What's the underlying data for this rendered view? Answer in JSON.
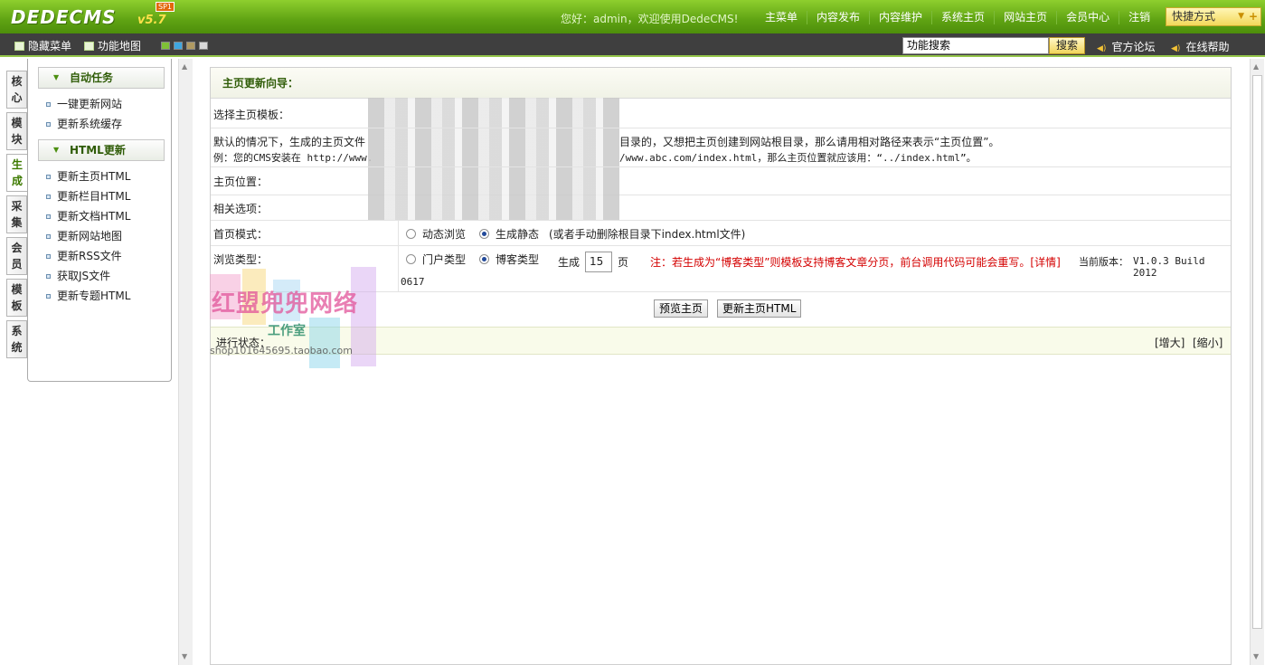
{
  "header": {
    "brand": "DEDECMS",
    "version": "v5.7",
    "sp": "SP1",
    "welcome": "您好：admin，欢迎使用DedeCMS!",
    "nav": [
      "主菜单",
      "内容发布",
      "内容维护",
      "系统主页",
      "网站主页",
      "会员中心",
      "注销"
    ],
    "quick_label": "快捷方式"
  },
  "toolbar": {
    "hide_menu": "隐藏菜单",
    "site_map": "功能地图",
    "search_value": "功能搜索",
    "search_btn": "搜索",
    "forum": "官方论坛",
    "help": "在线帮助"
  },
  "left_tabs": [
    {
      "l1": "核",
      "l2": "心"
    },
    {
      "l1": "模",
      "l2": "块"
    },
    {
      "l1": "生",
      "l2": "成"
    },
    {
      "l1": "采",
      "l2": "集"
    },
    {
      "l1": "会",
      "l2": "员"
    },
    {
      "l1": "模",
      "l2": "板"
    },
    {
      "l1": "系",
      "l2": "统"
    }
  ],
  "menu": {
    "group1": "自动任务",
    "group1_items": [
      "一键更新网站",
      "更新系统缓存"
    ],
    "group2": "HTML更新",
    "group2_items": [
      "更新主页HTML",
      "更新栏目HTML",
      "更新文档HTML",
      "更新网站地图",
      "更新RSS文件",
      "获取JS文件",
      "更新专题HTML"
    ]
  },
  "panel": {
    "title": "主页更新向导：",
    "template_label": "选择主页模板：",
    "desc_line1_a": "默认的情况下，生成的主页文件",
    "desc_line1_b": "目录的，又想把主页创建到网站根目录，那么请用相对路径来表示“主页位置”。",
    "desc_line2_a": "例：您的CMS安装在 http://www.",
    "desc_line2_b": "/www.abc.com/index.html，那么主页位置就应该用：“../index.html”。",
    "position_label": "主页位置：",
    "options_label": "相关选项：",
    "mode_label": "首页模式：",
    "mode_dynamic": "动态浏览",
    "mode_static": "生成静态",
    "mode_note": "(或者手动删除根目录下index.html文件)",
    "type_label": "浏览类型：",
    "type_portal": "门户类型",
    "type_blog": "博客类型",
    "generate": "生成",
    "pages_value": "15",
    "pages_unit": "页",
    "warning": "注：若生成为“博客类型”则模板支持博客文章分页，前台调用代码可能会重写。[详情]",
    "current_version_label": "当前版本：",
    "current_version_line1": "V1.0.3 Build 2012",
    "current_version_line2": "0617",
    "preview_btn": "预览主页",
    "update_btn": "更新主页HTML",
    "status_label": "进行状态：",
    "enlarge": "[增大]",
    "shrink": "[缩小]"
  },
  "watermark": {
    "line1": "红盟兜兜网络",
    "line2": "工作室",
    "line3": "shop101645695.taobao.com"
  },
  "colors": {
    "header_green": "#5fa313",
    "title_green": "#2f5c07",
    "warning_red": "#d40000"
  }
}
